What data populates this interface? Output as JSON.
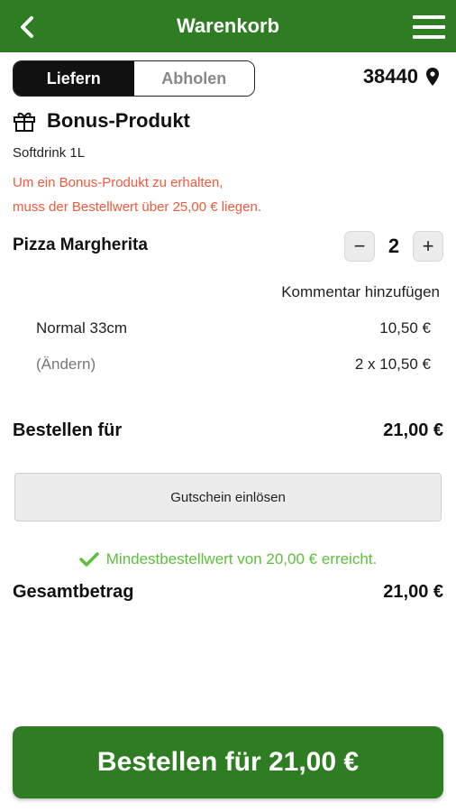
{
  "header": {
    "title": "Warenkorb",
    "back_icon": "chevron-left-icon",
    "menu_icon": "hamburger-menu-icon",
    "bg_color": "#2f7d22"
  },
  "delivery_toggle": {
    "options": [
      "Liefern",
      "Abholen"
    ],
    "selected": "Liefern"
  },
  "location": {
    "zip": "38440",
    "icon": "map-pin-icon"
  },
  "bonus": {
    "icon": "gift-icon",
    "title": "Bonus-Produkt",
    "item": "Softdrink 1L",
    "warning_line1": "Um ein Bonus-Produkt zu erhalten,",
    "warning_line2": "muss der Bestellwert über 25,00 € liegen.",
    "warning_color": "#f05a3a"
  },
  "cart_item": {
    "name": "Pizza Margherita",
    "quantity": "2",
    "decrement_label": "−",
    "increment_label": "+",
    "comment_link": "Kommentar hinzufügen",
    "size": "Normal 33cm",
    "unit_price": "10,50 €",
    "change_link": "(Ändern)",
    "qty_price": "2 x 10,50 €"
  },
  "subtotal": {
    "label": "Bestellen für",
    "value": "21,00 €"
  },
  "coupon": {
    "label": "Gutschein einlösen"
  },
  "minimum": {
    "icon": "check-icon",
    "text": "Mindestbestellwert von 20,00 € erreicht.",
    "color": "#5fbf3b"
  },
  "total": {
    "label": "Gesamtbetrag",
    "value": "21,00 €"
  },
  "order_button": {
    "label": "Bestellen für 21,00 €"
  }
}
